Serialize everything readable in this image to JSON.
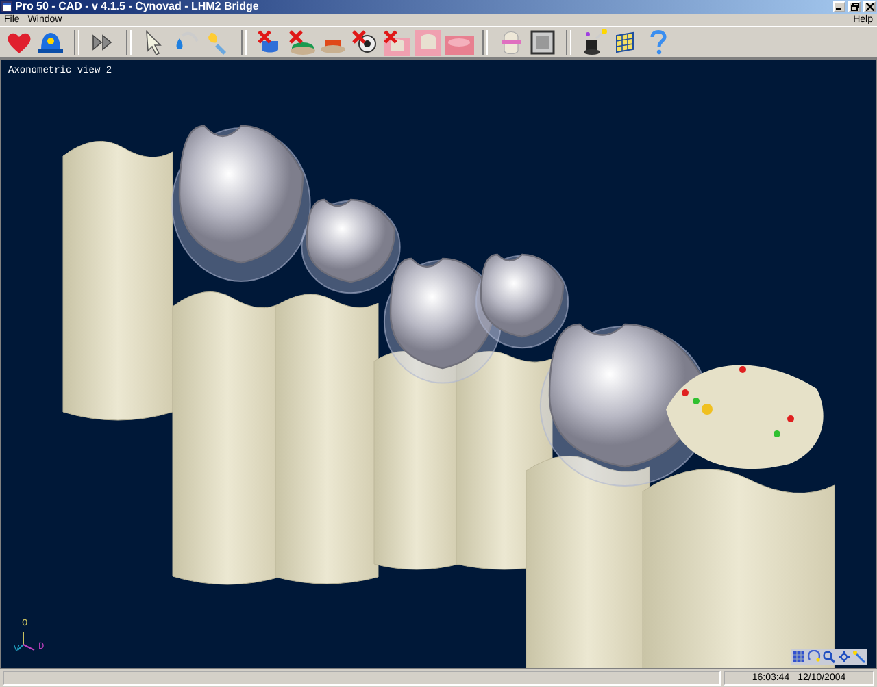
{
  "window": {
    "title": "Pro 50 - CAD - v 4.1.5 - Cynovad - LHM2 Bridge"
  },
  "menu": [
    "File",
    "Window"
  ],
  "menu_right": [
    "Help"
  ],
  "viewport": {
    "title": "Axonometric view 2",
    "axes": [
      "O",
      "D",
      "V"
    ]
  },
  "status_bar": {
    "time": "16:03:44",
    "date": "12/10/2004"
  }
}
